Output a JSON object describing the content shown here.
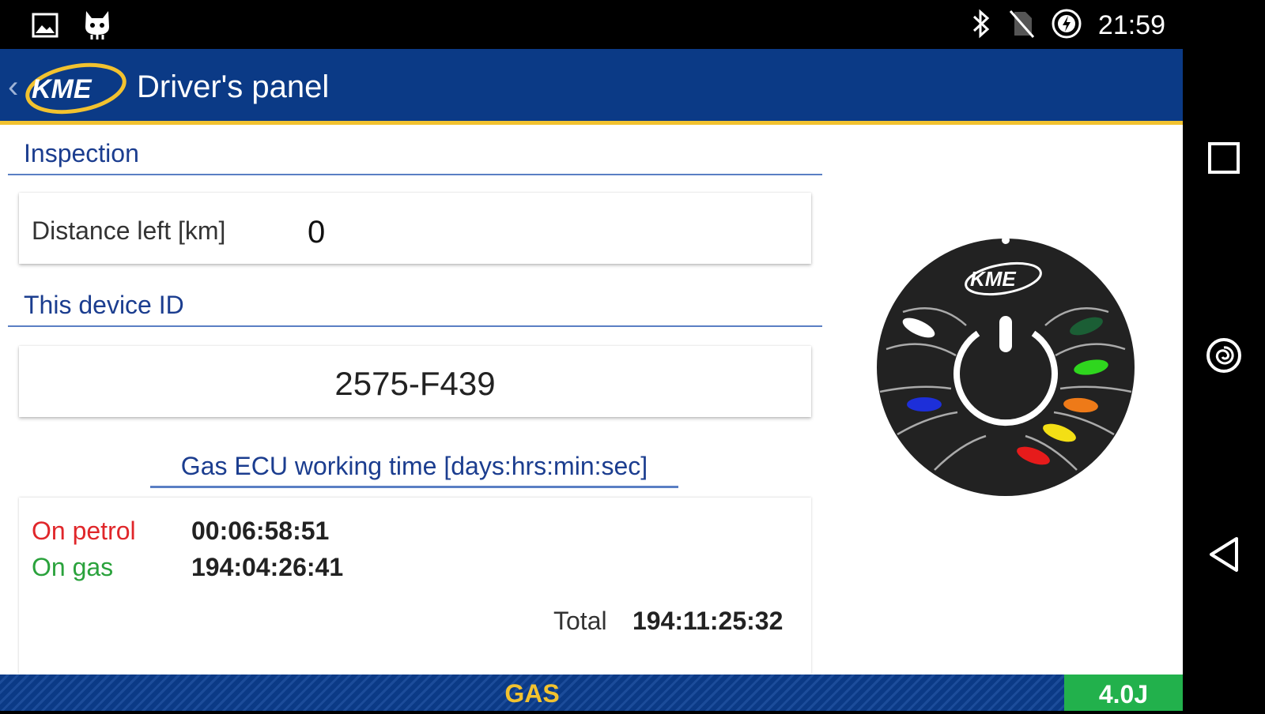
{
  "status_bar": {
    "time": "21:59",
    "left_icons": [
      "image-icon",
      "cat-icon"
    ],
    "right_icons": [
      "bluetooth-icon",
      "no-sim-icon",
      "battery-charging-icon"
    ]
  },
  "app_bar": {
    "logo_text": "KME",
    "title": "Driver's panel"
  },
  "inspection": {
    "section_title": "Inspection",
    "distance_label": "Distance left [km]",
    "distance_value": "0"
  },
  "device": {
    "section_title": "This device ID",
    "id": "2575-F439"
  },
  "ecu_time": {
    "section_title": "Gas ECU working time [days:hrs:min:sec]",
    "petrol_label": "On petrol",
    "petrol_value": "00:06:58:51",
    "gas_label": "On gas",
    "gas_value": "194:04:26:41",
    "total_label": "Total",
    "total_value": "194:11:25:32"
  },
  "panel_switch": {
    "logo_text": "KME",
    "led_colors": [
      "#ffffff",
      "#1b5e35",
      "#2fd61e",
      "#1d2fd9",
      "#ee7a18",
      "#f3df15",
      "#e61b1b"
    ]
  },
  "bottom_bar": {
    "mode": "GAS",
    "version": "4.0J"
  },
  "nav_bar": {
    "buttons": [
      "recent-apps-icon",
      "home-icon",
      "back-icon"
    ]
  },
  "colors": {
    "brand_blue": "#0b3a86",
    "accent_yellow": "#f2c22f",
    "petrol_red": "#e0262a",
    "gas_green": "#2aa23c",
    "version_green": "#22b14c"
  }
}
